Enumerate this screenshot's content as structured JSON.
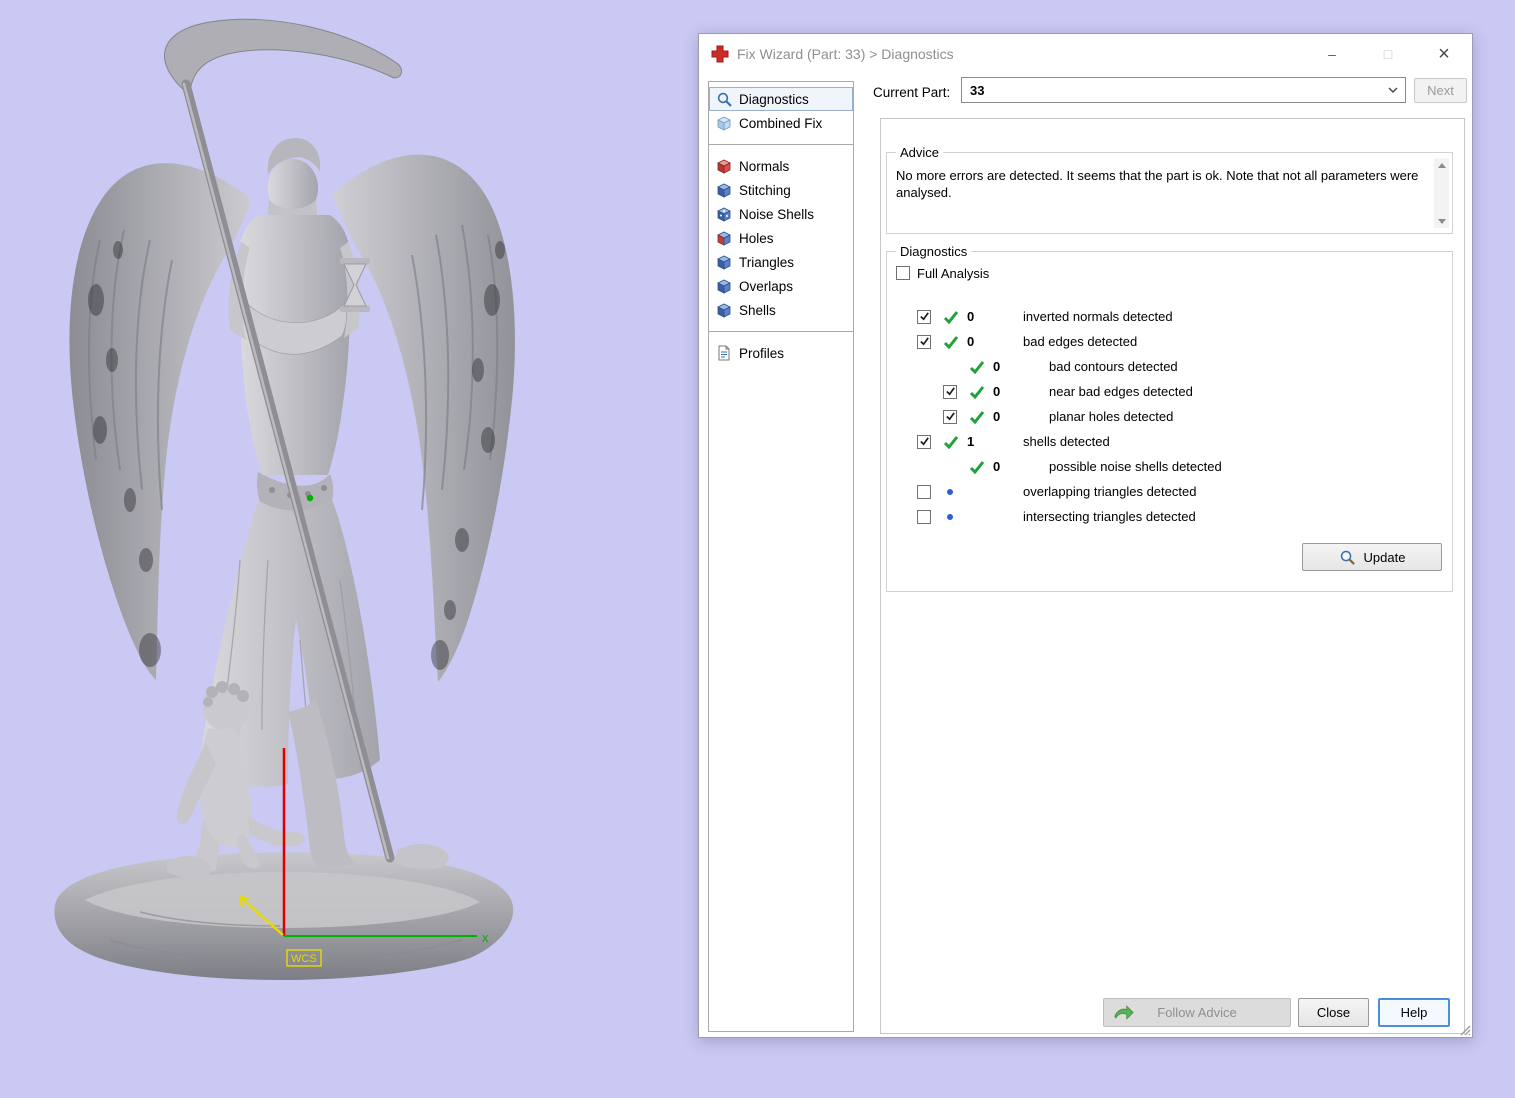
{
  "window": {
    "title": "Fix Wizard (Part: 33) > Diagnostics",
    "controls": {
      "minimize": "–",
      "maximize": "□",
      "close": "×"
    }
  },
  "viewport": {
    "axis_x_label": "x",
    "wcs_label": "WCS"
  },
  "sidebar": {
    "groups": [
      {
        "items": [
          {
            "label": "Diagnostics",
            "icon": "magnifier-icon",
            "selected": true
          },
          {
            "label": "Combined Fix",
            "icon": "cube-icon",
            "selected": false
          }
        ]
      },
      {
        "items": [
          {
            "label": "Normals",
            "icon": "cube-red-icon"
          },
          {
            "label": "Stitching",
            "icon": "cube-blue-icon"
          },
          {
            "label": "Noise Shells",
            "icon": "cube-dots-icon"
          },
          {
            "label": "Holes",
            "icon": "cube-red-blue-icon"
          },
          {
            "label": "Triangles",
            "icon": "cube-blue-icon"
          },
          {
            "label": "Overlaps",
            "icon": "cube-blue-icon"
          },
          {
            "label": "Shells",
            "icon": "cube-blue-icon"
          }
        ]
      },
      {
        "items": [
          {
            "label": "Profiles",
            "icon": "document-icon"
          }
        ]
      }
    ]
  },
  "toolbar": {
    "current_part_label": "Current Part:",
    "current_part_value": "33",
    "next_label": "Next"
  },
  "advice": {
    "title": "Advice",
    "text": "No more errors are detected. It seems that the part is ok. Note that not all parameters were analysed."
  },
  "diagnostics": {
    "title": "Diagnostics",
    "full_analysis_label": "Full Analysis",
    "update_label": "Update",
    "rows": [
      {
        "label": "inverted normals detected",
        "count": "0",
        "status": "ok",
        "checkbox": true,
        "checked": true,
        "indent": 0
      },
      {
        "label": "bad edges detected",
        "count": "0",
        "status": "ok",
        "checkbox": true,
        "checked": true,
        "indent": 0
      },
      {
        "label": "bad contours detected",
        "count": "0",
        "status": "ok",
        "checkbox": false,
        "checked": null,
        "indent": 1
      },
      {
        "label": "near bad edges detected",
        "count": "0",
        "status": "ok",
        "checkbox": true,
        "checked": true,
        "indent": 1
      },
      {
        "label": "planar holes detected",
        "count": "0",
        "status": "ok",
        "checkbox": true,
        "checked": true,
        "indent": 1
      },
      {
        "label": "shells detected",
        "count": "1",
        "status": "ok",
        "checkbox": true,
        "checked": true,
        "indent": 0
      },
      {
        "label": "possible noise shells detected",
        "count": "0",
        "status": "ok",
        "checkbox": false,
        "checked": null,
        "indent": 1
      },
      {
        "label": "overlapping triangles detected",
        "count": "",
        "status": "not-analysed",
        "checkbox": true,
        "checked": false,
        "indent": 0
      },
      {
        "label": "intersecting triangles detected",
        "count": "",
        "status": "not-analysed",
        "checkbox": true,
        "checked": false,
        "indent": 0
      }
    ]
  },
  "footer": {
    "follow_advice_label": "Follow Advice",
    "close_label": "Close",
    "help_label": "Help"
  },
  "colors": {
    "viewport_bg": "#c9c9f3",
    "status_ok_green": "#1fa23c",
    "not_analysed_blue": "#2b5fd9",
    "axis_x_green": "#00b400",
    "axis_z_red": "#dd0000",
    "wcs_yellow": "#e8da00",
    "help_focus_blue": "#4a90d9"
  }
}
